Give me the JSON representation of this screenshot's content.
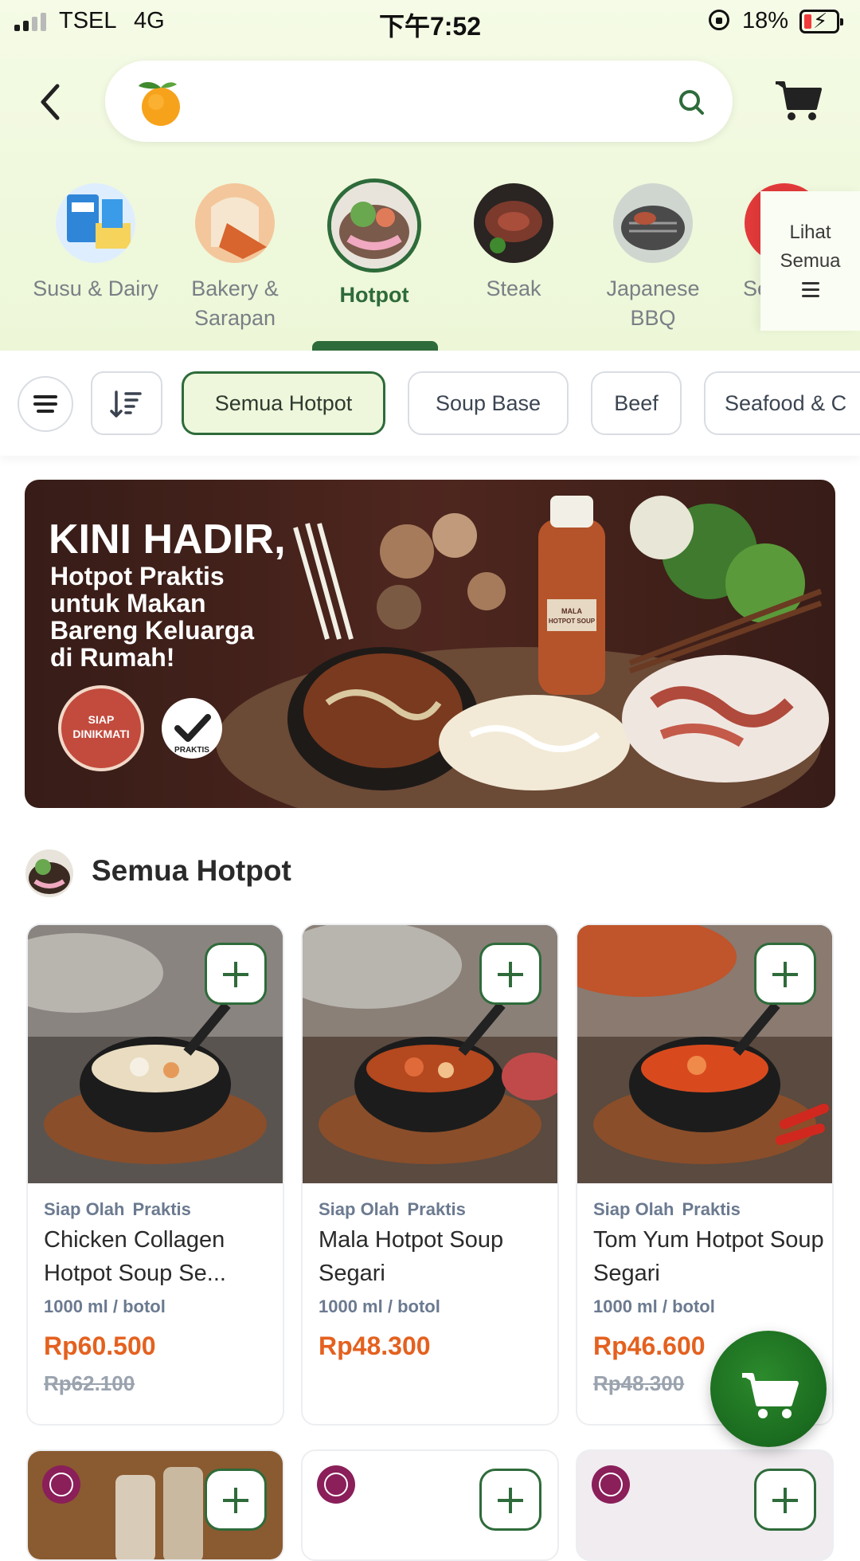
{
  "status_bar": {
    "carrier": "TSEL",
    "network": "4G",
    "time": "下午7:52",
    "battery": "18%"
  },
  "search": {
    "placeholder": ""
  },
  "categories": [
    {
      "label": "Susu & Dairy",
      "icon": "milk-dairy-icon"
    },
    {
      "label": "Bakery & Sarapan",
      "icon": "bread-icon"
    },
    {
      "label": "Hotpot",
      "icon": "hotpot-icon",
      "active": true
    },
    {
      "label": "Steak",
      "icon": "steak-icon"
    },
    {
      "label": "Japanese BBQ",
      "icon": "grill-icon"
    },
    {
      "label": "Se",
      "icon": "seafood-icon"
    }
  ],
  "see_all": {
    "line1": "Lihat",
    "line2": "Semua"
  },
  "filters": {
    "chips": [
      "Semua Hotpot",
      "Soup Base",
      "Beef",
      "Seafood & C"
    ]
  },
  "banner": {
    "headline": "KINI HADIR,",
    "line1": "Hotpot Praktis",
    "line2": "untuk Makan",
    "line3": "Bareng Keluarga",
    "line4": "di Rumah!",
    "badge1_line1": "SIAP",
    "badge1_line2": "DINIKMATI",
    "badge2": "PRAKTIS",
    "bottle_line1": "MALA",
    "bottle_line2": "HOTPOT SOUP"
  },
  "section": {
    "title": "Semua Hotpot"
  },
  "products": [
    {
      "tag1": "Siap Olah",
      "tag2": "Praktis",
      "name": "Chicken Collagen Hotpot Soup Se...",
      "unit": "1000 ml / botol",
      "price": "Rp60.500",
      "old_price": "Rp62.100"
    },
    {
      "tag1": "Siap Olah",
      "tag2": "Praktis",
      "name": "Mala Hotpot Soup Segari",
      "unit": "1000 ml / botol",
      "price": "Rp48.300",
      "old_price": ""
    },
    {
      "tag1": "Siap Olah",
      "tag2": "Praktis",
      "name": "Tom Yum Hotpot Soup Segari",
      "unit": "1000 ml / botol",
      "price": "Rp46.600",
      "old_price": "Rp48.300"
    }
  ],
  "colors": {
    "brand_green": "#2e6b3a",
    "price_orange": "#e4611f",
    "muted_text": "#6b7a90"
  }
}
